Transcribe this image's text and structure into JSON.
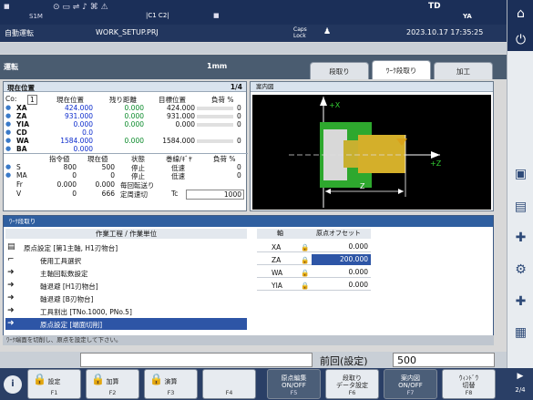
{
  "status_bar": {
    "left_items": [
      "S1M",
      "C1",
      "C2"
    ],
    "top_right": [
      "TD",
      "YA"
    ],
    "glyph_strings": [
      "■",
      "|C1 C2|",
      "■"
    ]
  },
  "title_bar": {
    "mode": "自動運転",
    "program": "WORK_SETUP.PRJ",
    "caps_lock": "Caps\nLock",
    "user_icon": "user-lock-icon",
    "datetime": "2023.10.17 17:35:25"
  },
  "op_bar": {
    "mode_label": "運転",
    "increment": "1mm",
    "tabs": [
      {
        "label": "段取り",
        "active": false
      },
      {
        "label": "ﾜｰｸ段取り",
        "active": true
      },
      {
        "label": "加工",
        "active": false
      }
    ]
  },
  "position_panel": {
    "title": "現在位置",
    "page": "1/4",
    "col_headers": [
      "Co:",
      "1",
      "現在位置",
      "残り距離",
      "目標位置",
      "負荷 %"
    ],
    "axes": [
      {
        "name": "XA",
        "current": "424.000",
        "remain": "0.000",
        "target": "424.000",
        "load": "0"
      },
      {
        "name": "ZA",
        "current": "931.000",
        "remain": "0.000",
        "target": "931.000",
        "load": "0"
      },
      {
        "name": "YIA",
        "current": "0.000",
        "remain": "0.000",
        "target": "0.000",
        "load": "0"
      },
      {
        "name": "CD",
        "current": "0.0",
        "remain": "",
        "target": "",
        "load": ""
      },
      {
        "name": "WA",
        "current": "1584.000",
        "remain": "0.000",
        "target": "1584.000",
        "load": "0"
      },
      {
        "name": "BA",
        "current": "0.000",
        "remain": "",
        "target": "",
        "load": ""
      }
    ],
    "spindle_headers": [
      "指令値",
      "現在値",
      "状態",
      "巻線/ｷﾞﾔ",
      "負荷 %"
    ],
    "spindles": [
      {
        "name": "S",
        "cmd": "800",
        "cur": "500",
        "state": "停止",
        "gear": "低速",
        "load": "0"
      },
      {
        "name": "MA",
        "cmd": "0",
        "cur": "0",
        "state": "停止",
        "gear": "低速",
        "load": "0"
      }
    ],
    "feed": [
      {
        "name": "Fr",
        "cmd": "0.000",
        "cur": "0.000",
        "label": "毎回転送り"
      },
      {
        "name": "V",
        "cmd": "0",
        "cur": "666",
        "label": "定周速切",
        "tc_label": "Tc",
        "tc": "1000"
      }
    ]
  },
  "guide_panel": {
    "title": "案内図",
    "labels": {
      "x": "+X",
      "z": "+Z",
      "dim": "Z"
    }
  },
  "work_setup": {
    "title": "ﾜｰｸ段取り",
    "list_header": "作業工程 / 作業単位",
    "steps": [
      {
        "icon": "setup-icon",
        "text": "原点設定 [第1主軸, H1刃物台]",
        "indent": false
      },
      {
        "icon": "tool-icon",
        "text": "使用工具選択",
        "indent": true
      },
      {
        "icon": "arrow-right-icon",
        "text": "主軸回転数設定",
        "indent": true
      },
      {
        "icon": "arrow-right-icon",
        "text": "軸退避 [H1刃物台]",
        "indent": true
      },
      {
        "icon": "arrow-right-icon",
        "text": "軸退避 [B刃物台]",
        "indent": true
      },
      {
        "icon": "arrow-right-icon",
        "text": "工具割出 [TNo.1000, PNo.5]",
        "indent": true
      },
      {
        "icon": "arrow-right-icon",
        "text": "原点設定 [端面切削]",
        "indent": true,
        "selected": true
      }
    ],
    "offset_headers": [
      "軸",
      "原点オフセット"
    ],
    "offsets": [
      {
        "axis": "XA",
        "value": "0.000",
        "selected": false
      },
      {
        "axis": "ZA",
        "value": "200.000",
        "selected": true
      },
      {
        "axis": "WA",
        "value": "0.000",
        "selected": false
      },
      {
        "axis": "YIA",
        "value": "0.000",
        "selected": false
      }
    ],
    "message": "ﾜｰｸ端面を切削し、原点を設定して下さい。"
  },
  "input_bar": {
    "label": "前回(設定)",
    "value": "500"
  },
  "function_keys": [
    {
      "label": "設定",
      "fn": "F1",
      "lock": true
    },
    {
      "label": "加算",
      "fn": "F2",
      "lock": true
    },
    {
      "label": "演算",
      "fn": "F3",
      "lock": true
    },
    {
      "label": "",
      "fn": "F4",
      "lock": false
    },
    {
      "label": "原点編集\nON/OFF",
      "fn": "F5",
      "dark": true
    },
    {
      "label": "段取り\nデータ設定",
      "fn": "F6",
      "dark": false
    },
    {
      "label": "案内図\nON/OFF",
      "fn": "F7",
      "dark": true
    },
    {
      "label": "ｳｨﾝﾄﾞｳ\n切替",
      "fn": "F8",
      "dark": false
    }
  ],
  "page_indicator": "2/4",
  "colors": {
    "accent": "#2d55a6",
    "header": "#1b2f58",
    "yellow": "#d9a21a",
    "green": "#33cc33"
  }
}
